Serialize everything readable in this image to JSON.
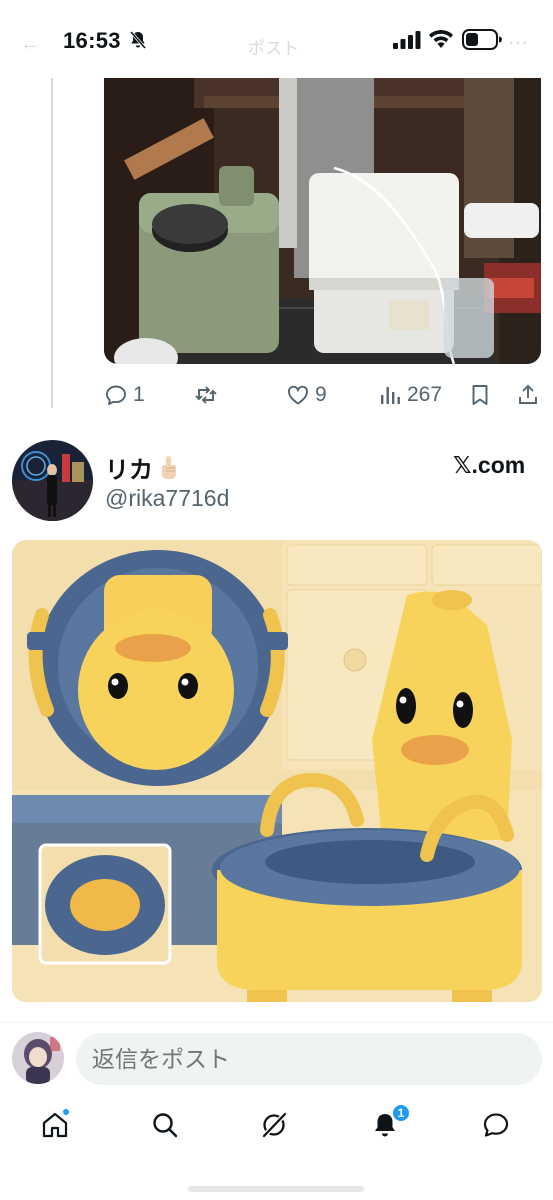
{
  "status_bar": {
    "time": "16:53",
    "faded_header_title": "ポスト"
  },
  "previous_tweet": {
    "image_description_icon": "storage-photo",
    "actions": {
      "replies": "1",
      "retweets": "",
      "likes": "9",
      "views": "267"
    }
  },
  "tweet": {
    "display_name": "リカ",
    "handle": "@rika7716d",
    "link_domain": "𝕏.com",
    "image_icon": "duck-potty-photo"
  },
  "reply_bar": {
    "placeholder": "返信をポスト"
  },
  "bottom_nav": {
    "notification_count": "1",
    "colors": {
      "accent": "#1d9bf0",
      "text_secondary": "#536471"
    }
  }
}
